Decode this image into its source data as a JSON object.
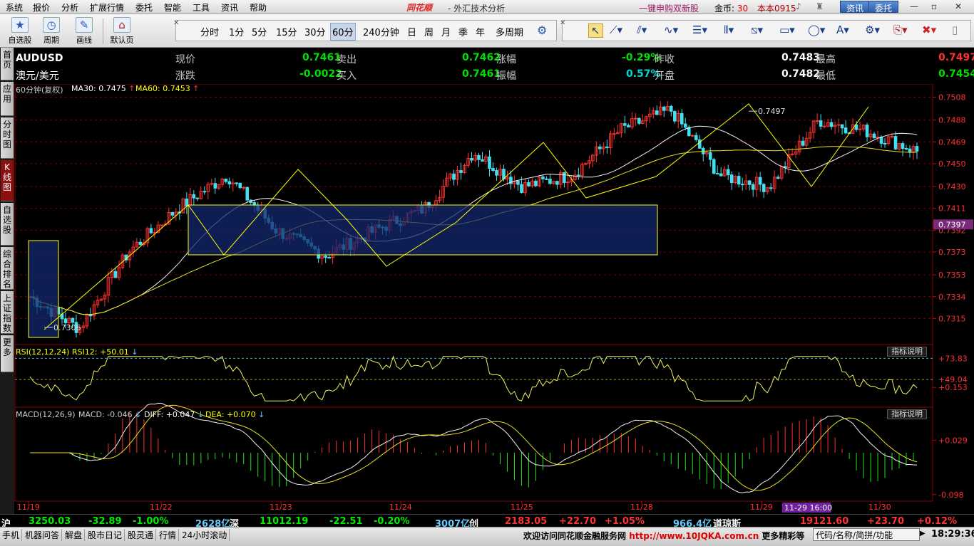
{
  "menu": {
    "items": [
      "系统",
      "报价",
      "分析",
      "扩展行情",
      "委托",
      "智能",
      "工具",
      "资讯",
      "帮助"
    ],
    "brand": "同花顺",
    "app_title": "- 外汇技术分析",
    "promo": "一键申购双新股",
    "gold_label": "金币:",
    "gold_value": "30",
    "version": "本本0915",
    "btn_news": "资讯",
    "btn_trade": "委托"
  },
  "toolbar": {
    "tools": [
      {
        "label": "自选股",
        "icon": "star-icon"
      },
      {
        "label": "周期",
        "icon": "clock-icon"
      },
      {
        "label": "画线",
        "icon": "pencil-icon"
      },
      {
        "label": "默认页",
        "icon": "home-icon"
      }
    ],
    "periods": [
      "分时",
      "1分",
      "5分",
      "15分",
      "30分",
      "60分",
      "240分钟",
      "日",
      "周",
      "月",
      "季",
      "年",
      "多周期"
    ],
    "selected_period": "60分"
  },
  "leftnav": {
    "items": [
      "首页",
      "应用",
      "分时图",
      "K线图",
      "自选股",
      "综合排名",
      "上证指数",
      "更多"
    ],
    "active": "K线图"
  },
  "quote": {
    "symbol": "AUDUSD",
    "name": "澳元/美元",
    "row1": [
      {
        "label": "现价",
        "value": "0.7461"
      },
      {
        "label": "卖出",
        "value": "0.7462"
      },
      {
        "label": "涨幅",
        "value": "-0.29%"
      },
      {
        "label": "昨收",
        "value": "0.7483"
      },
      {
        "label": "最高",
        "value": "0.7497"
      }
    ],
    "row2": [
      {
        "label": "涨跌",
        "value": "-0.0022"
      },
      {
        "label": "买入",
        "value": "0.7461"
      },
      {
        "label": "振幅",
        "value": "0.57%"
      },
      {
        "label": "开盘",
        "value": "0.7482"
      },
      {
        "label": "最低",
        "value": "0.7454"
      }
    ]
  },
  "indicators": {
    "main_legend": "60分钟(复权)",
    "ma30": "MA30: 0.7475",
    "ma60": "MA60: 0.7453",
    "rsi_legend": "RSI(12,12,24)  RSI12: +50.01",
    "macd_legend": "MACD(12,26,9)",
    "macd_val": "MACD: -0.046",
    "diff_val": "DIFF: +0.047",
    "dea_val": "DEA: +0.070",
    "hint": "指标说明"
  },
  "chart_data": {
    "type": "candlestick",
    "y_ticks": [
      "0.7508",
      "0.7488",
      "0.7469",
      "0.7450",
      "0.7430",
      "0.7411",
      "0.7392",
      "0.7373",
      "0.7353",
      "0.7334",
      "0.7315"
    ],
    "ylim": [
      0.7296,
      0.7512
    ],
    "current_price_tag": "0.7397",
    "annot_high": "0.7497",
    "annot_low": "0.7306",
    "rsi_ticks": [
      "+73.83",
      "+49.04"
    ],
    "macd_ticks": [
      "+0.153",
      "+0.029",
      "-0.098"
    ],
    "x_labels": [
      "11/19",
      "11/22",
      "11/23",
      "11/24",
      "11/25",
      "11/28",
      "11/29",
      "11/30"
    ],
    "cursor_label": "11-29 16:00",
    "key_closes": [
      0.7334,
      0.7306,
      0.7373,
      0.7411,
      0.744,
      0.7392,
      0.737,
      0.7392,
      0.7411,
      0.746,
      0.743,
      0.744,
      0.748,
      0.7497,
      0.744,
      0.743,
      0.7488,
      0.7478,
      0.7461
    ]
  },
  "ticker": {
    "sh": "沪",
    "sh_val": "3250.03",
    "sh_chg": "-32.89",
    "sh_pct": "-1.00%",
    "sh_amt": "2628亿",
    "sz": "深",
    "sz_val": "11012.19",
    "sz_chg": "-22.51",
    "sz_pct": "-0.20%",
    "sz_amt": "3007亿",
    "cy": "创",
    "cy_val": "2183.05",
    "cy_chg": "+22.70",
    "cy_pct": "+1.05%",
    "cy_amt": "966.4亿",
    "dj": "道琼斯",
    "dj_val": "19121.60",
    "dj_chg": "+23.70",
    "dj_pct": "+0.12%"
  },
  "statusbar": {
    "items": [
      "手机",
      "机器问答",
      "解盘",
      "股市日记",
      "股灵通",
      "行情",
      "24小时滚动"
    ],
    "welcome": "欢迎访问同花顺金融服务网",
    "url": "http://www.10JQKA.com.cn",
    "more": "更多精彩等",
    "code_btn": "代码/名称/简拼/功能",
    "clock": "18:29:36"
  }
}
